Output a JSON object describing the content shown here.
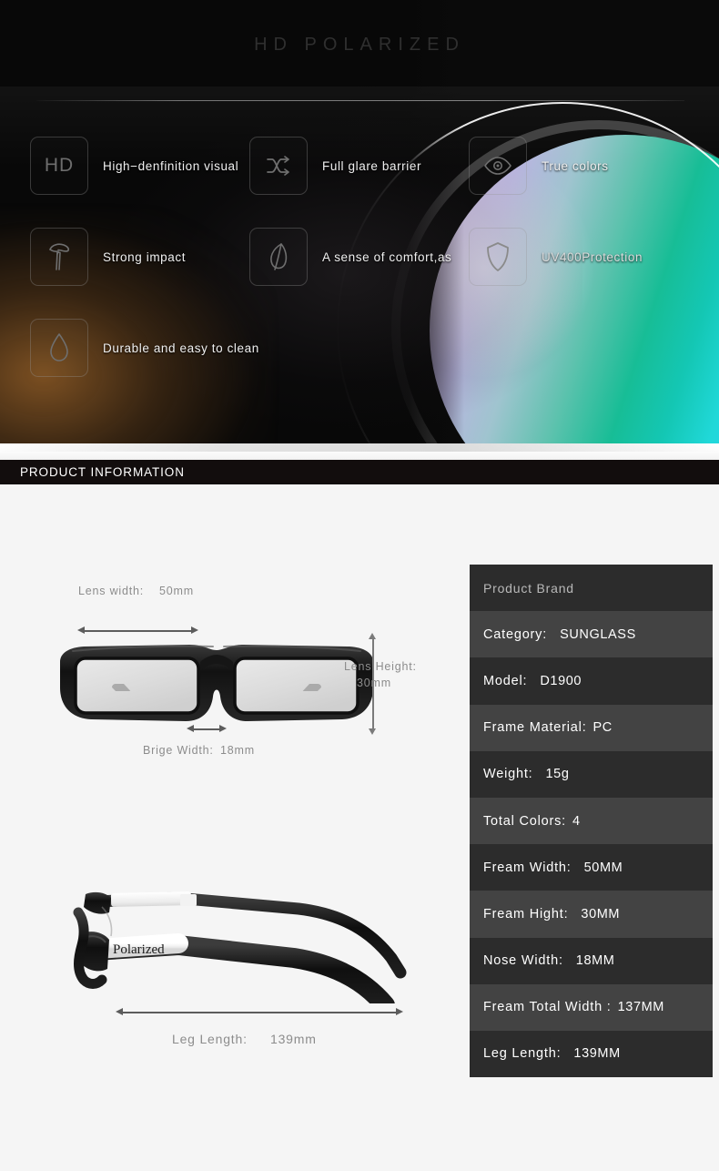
{
  "hero": {
    "title": "HD POLARIZED",
    "features": [
      {
        "icon": "hd-icon",
        "icon_text": "HD",
        "label": "High−denfinition visual"
      },
      {
        "icon": "shuffle-icon",
        "icon_text": "",
        "label": "Full glare barrier"
      },
      {
        "icon": "eye-icon",
        "icon_text": "",
        "label": "True colors"
      },
      {
        "icon": "hammer-icon",
        "icon_text": "",
        "label": "Strong impact"
      },
      {
        "icon": "leaf-icon",
        "icon_text": "",
        "label": "A sense of comfort,as"
      },
      {
        "icon": "shield-icon",
        "icon_text": "",
        "label": "UV400Protection"
      },
      {
        "icon": "droplet-icon",
        "icon_text": "",
        "label": "Durable and easy to clean"
      }
    ],
    "lens_gradient_colors": [
      "#cfc9d4",
      "#c4b4e2",
      "#5ec2ae",
      "#17bd96",
      "#20d8d8",
      "#26a8f7"
    ]
  },
  "section_bar": {
    "title": "PRODUCT INFORMATION"
  },
  "diagram": {
    "front": {
      "lens_width_label": "Lens width:",
      "lens_width_value": "50mm",
      "lens_height_label": "Lens Height:",
      "lens_height_value": "30mm",
      "bridge_label": "Brige Width:",
      "bridge_value": "18mm"
    },
    "side": {
      "temple_print": "Polarized",
      "leg_length_label": "Leg Length:",
      "leg_length_value": "139mm"
    }
  },
  "spec_table": {
    "rows": [
      {
        "key": "Product Brand",
        "value": ""
      },
      {
        "key": "Category:",
        "value": "SUNGLASS"
      },
      {
        "key": "Model:",
        "value": "D1900"
      },
      {
        "key": "Frame Material:",
        "value": "PC"
      },
      {
        "key": "Weight:",
        "value": "15g"
      },
      {
        "key": "Total Colors:",
        "value": "4"
      },
      {
        "key": "Fream Width:",
        "value": "50MM"
      },
      {
        "key": "Fream Hight:",
        "value": "30MM"
      },
      {
        "key": "Nose Width:",
        "value": "18MM"
      },
      {
        "key": "Fream Total Width :",
        "value": "137MM"
      },
      {
        "key": "Leg Length:",
        "value": "139MM"
      }
    ]
  },
  "colors": {
    "hero_bg": "#0a0a0a",
    "bar_bg": "#120d0d",
    "page_bg": "#f5f5f5",
    "row_dark": "#2c2c2c",
    "row_light": "#434343",
    "dim_text": "#8c8c8c"
  }
}
